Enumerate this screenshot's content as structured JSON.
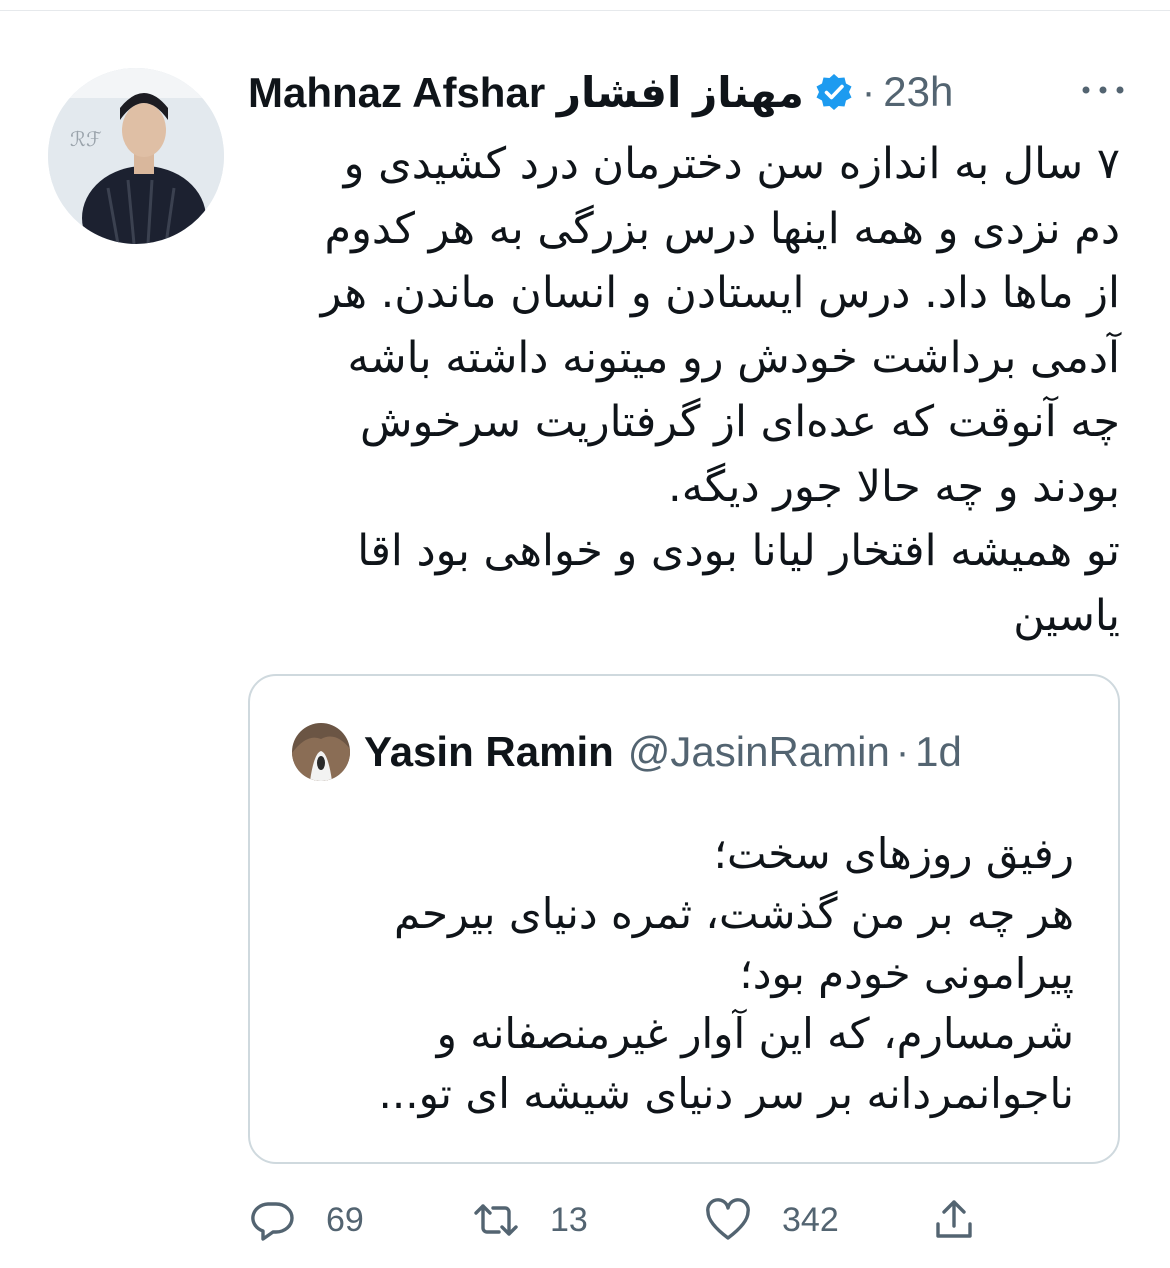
{
  "tweet": {
    "author_name": "Mahnaz Afshar مهناز افشار",
    "verified_icon": "verified-badge-icon",
    "separator": "·",
    "time": "23h",
    "more_icon": "more-dots-icon",
    "text_lines": [
      "۷ سال به اندازه سن دخترمان درد کشیدی و",
      "دم نزدی و همه اینها درس بزرگی به هر کدوم",
      "از ماها داد. درس ایستادن و انسان ماندن. هر",
      "آدمی برداشت خودش رو میتونه داشته باشه",
      "چه آنوقت که عده‌ای از گرفتاریت سرخوش",
      "بودند و چه حالا جور دیگه.",
      "تو همیشه افتخار لیانا بودی و خواهی بود اقا",
      "یاسین"
    ]
  },
  "quoted": {
    "name": "Yasin Ramin",
    "handle": "@JasinRamin",
    "separator": "·",
    "time": "1d",
    "text_lines": [
      "رفیق روزهای سخت؛",
      "هر چه بر من گذشت، ثمره دنیای بیرحم",
      "پیرامونی خودم بود؛",
      "شرمسارم، که این آوار غیرمنصفانه و",
      "ناجوانمردانه بر سر دنیای شیشه ای تو..."
    ]
  },
  "actions": {
    "reply_count": "69",
    "retweet_count": "13",
    "like_count": "342",
    "reply_icon": "reply-icon",
    "retweet_icon": "retweet-icon",
    "like_icon": "heart-icon",
    "share_icon": "share-icon"
  },
  "colors": {
    "text": "#0f1419",
    "secondary": "#536471",
    "verified": "#1d9bf0",
    "border": "#cfd9de"
  }
}
